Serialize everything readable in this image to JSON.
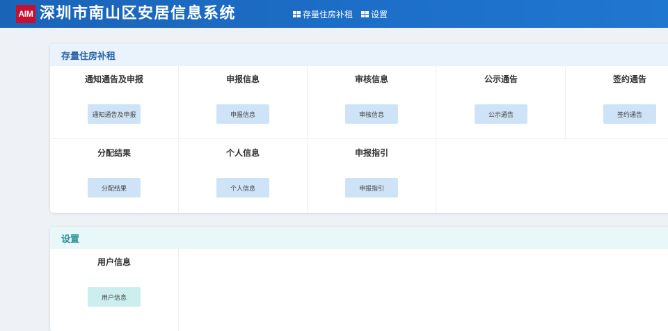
{
  "header": {
    "logo_text": "AIM",
    "title": "深圳市南山区安居信息系统",
    "nav": [
      {
        "label": "存量住房补租",
        "icon": "grid-icon"
      },
      {
        "label": "设置",
        "icon": "grid-icon"
      }
    ]
  },
  "sections": [
    {
      "title": "存量住房补租",
      "items": [
        {
          "title": "通知通告及申报",
          "button": "通知通告及申报"
        },
        {
          "title": "申报信息",
          "button": "申报信息"
        },
        {
          "title": "审核信息",
          "button": "审核信息"
        },
        {
          "title": "公示通告",
          "button": "公示通告"
        },
        {
          "title": "签约通告",
          "button": "签约通告"
        },
        {
          "title": "分配结果",
          "button": "分配结果"
        },
        {
          "title": "个人信息",
          "button": "个人信息"
        },
        {
          "title": "申报指引",
          "button": "申报指引"
        }
      ]
    },
    {
      "title": "设置",
      "items": [
        {
          "title": "用户信息",
          "button": "用户信息"
        }
      ]
    }
  ],
  "colors": {
    "header": "#1d6fc9",
    "logo": "#c8102e",
    "section1_head": "#eaf3fc",
    "section2_head": "#e8f7f7",
    "button_blue": "#cfe3f7",
    "button_teal": "#cdeeee"
  }
}
